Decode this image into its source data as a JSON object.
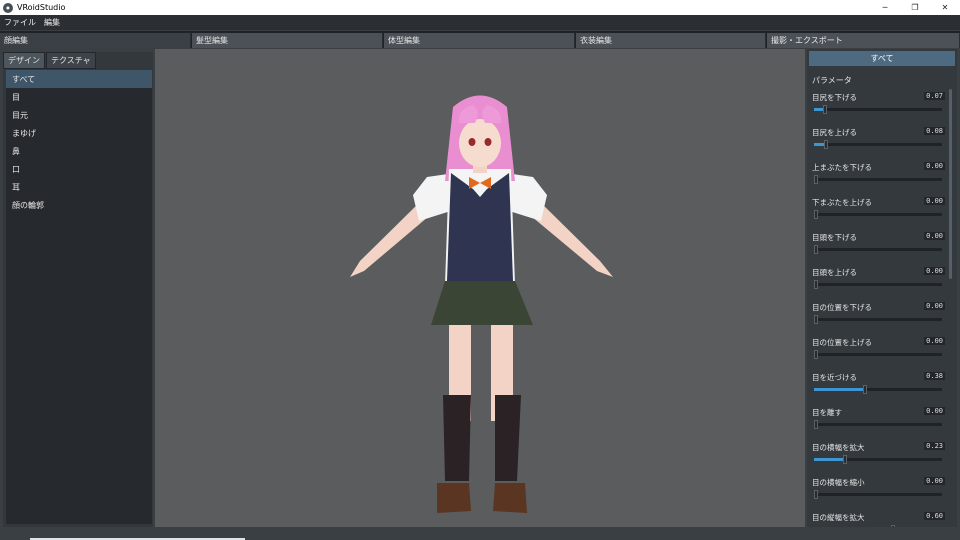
{
  "window": {
    "title": "VRoidStudio",
    "minimize": "─",
    "maximize": "❐",
    "close": "✕"
  },
  "menu": {
    "items": [
      "ファイル",
      "編集"
    ]
  },
  "top_tabs": [
    "顔編集",
    "髪型編集",
    "体型編集",
    "衣装編集",
    "撮影・エクスポート"
  ],
  "left": {
    "subtabs": [
      "デザイン",
      "テクスチャ"
    ],
    "categories": [
      "すべて",
      "目",
      "目元",
      "まゆげ",
      "鼻",
      "口",
      "耳",
      "顔の輪郭"
    ]
  },
  "right": {
    "all_button": "すべて",
    "section_title": "パラメータ",
    "params": [
      {
        "label": "目尻を下げる",
        "value": "0.07",
        "level": 0.07
      },
      {
        "label": "目尻を上げる",
        "value": "0.08",
        "level": 0.08
      },
      {
        "label": "上まぶたを下げる",
        "value": "0.00",
        "level": 0
      },
      {
        "label": "下まぶたを上げる",
        "value": "0.00",
        "level": 0
      },
      {
        "label": "目頭を下げる",
        "value": "0.00",
        "level": 0
      },
      {
        "label": "目頭を上げる",
        "value": "0.00",
        "level": 0
      },
      {
        "label": "目の位置を下げる",
        "value": "0.00",
        "level": 0
      },
      {
        "label": "目の位置を上げる",
        "value": "0.00",
        "level": 0
      },
      {
        "label": "目を近づける",
        "value": "0.38",
        "level": 0.38
      },
      {
        "label": "目を離す",
        "value": "0.00",
        "level": 0
      },
      {
        "label": "目の横幅を拡大",
        "value": "0.23",
        "level": 0.23
      },
      {
        "label": "目の横幅を縮小",
        "value": "0.00",
        "level": 0
      },
      {
        "label": "目の縦幅を拡大",
        "value": "0.60",
        "level": 0.6
      }
    ]
  },
  "colors": {
    "accent": "#3d95d2",
    "selected": "#3e5668",
    "viewport_bg": "#5a5c5e"
  }
}
